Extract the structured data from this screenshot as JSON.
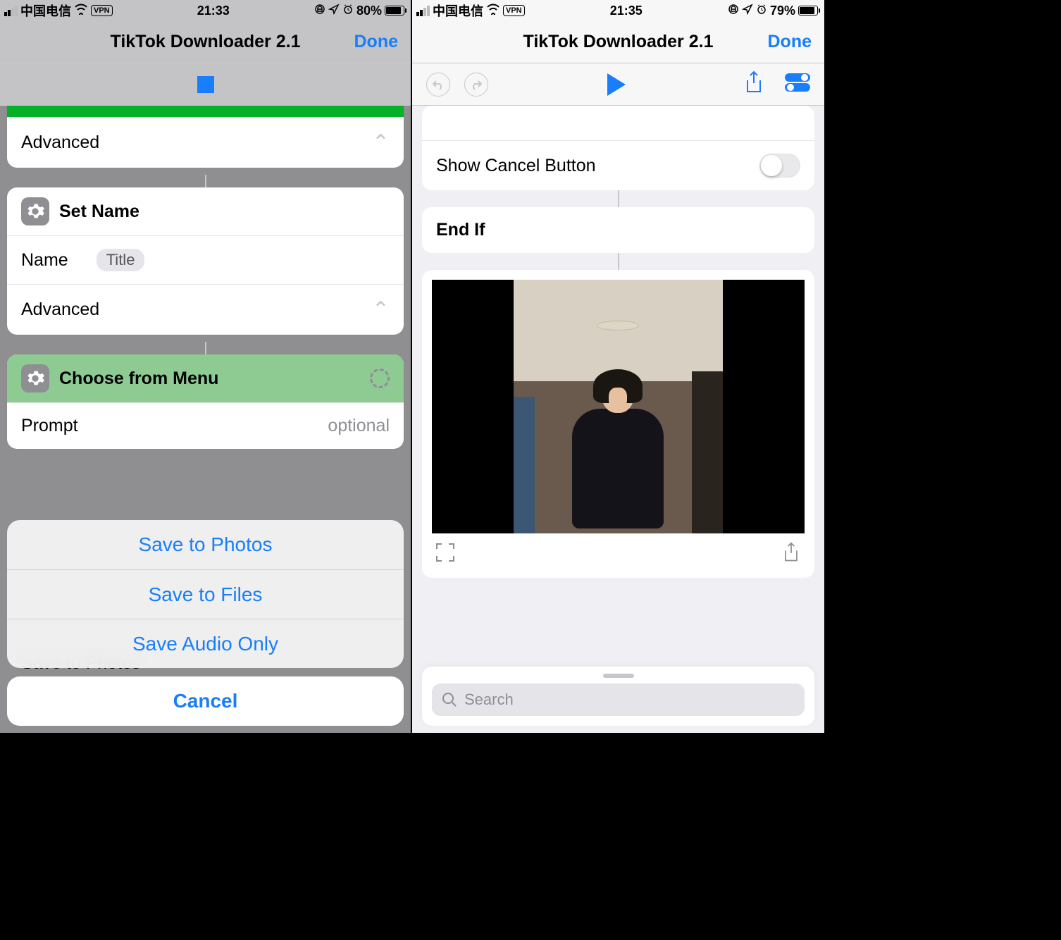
{
  "left": {
    "status": {
      "carrier": "中国电信",
      "vpn": "VPN",
      "time": "21:33",
      "battery_pct": "80%",
      "battery_fill_css": "width:80%"
    },
    "nav": {
      "title": "TikTok Downloader 2.1",
      "done": "Done"
    },
    "cards": {
      "advanced0": "Advanced",
      "setname_header": "Set Name",
      "name_label": "Name",
      "name_token": "Title",
      "advanced1": "Advanced",
      "menu_header": "Choose from Menu",
      "prompt_label": "Prompt",
      "prompt_placeholder": "optional",
      "save_to_photos_bg": "Save to Photos"
    },
    "sheet": {
      "opt1": "Save to Photos",
      "opt2": "Save to Files",
      "opt3": "Save Audio Only",
      "cancel": "Cancel"
    }
  },
  "right": {
    "status": {
      "carrier": "中国电信",
      "vpn": "VPN",
      "time": "21:35",
      "battery_pct": "79%",
      "battery_fill_css": "width:79%"
    },
    "nav": {
      "title": "TikTok Downloader 2.1",
      "done": "Done"
    },
    "rows": {
      "show_cancel": "Show Cancel Button",
      "endif": "End If"
    },
    "search_placeholder": "Search"
  }
}
